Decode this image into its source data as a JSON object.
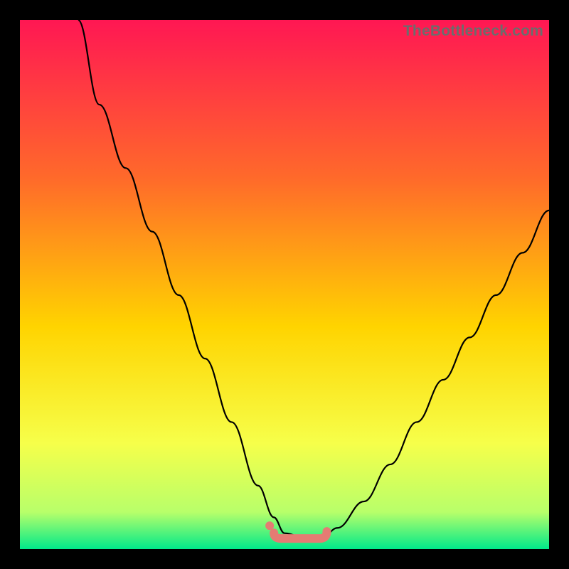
{
  "watermark": "TheBottleneck.com",
  "gradient_colors": {
    "top": "#ff1753",
    "upper_mid": "#ff6a2a",
    "mid": "#ffd400",
    "lower_mid": "#f6ff4a",
    "near_bottom": "#b8ff6a",
    "bottom": "#00e98a"
  },
  "curve_stroke": "#000000",
  "valley_marker_color": "#e57b73",
  "chart_data": {
    "type": "line",
    "title": "",
    "xlabel": "",
    "ylabel": "",
    "xlim": [
      0,
      100
    ],
    "ylim": [
      0,
      100
    ],
    "series": [
      {
        "name": "bottleneck-curve",
        "x": [
          11,
          15,
          20,
          25,
          30,
          35,
          40,
          45,
          48,
          50,
          54,
          57,
          60,
          65,
          70,
          75,
          80,
          85,
          90,
          95,
          100
        ],
        "y": [
          100,
          84,
          72,
          60,
          48,
          36,
          24,
          12,
          6,
          3,
          2,
          2,
          4,
          9,
          16,
          24,
          32,
          40,
          48,
          56,
          64
        ]
      }
    ],
    "valley": {
      "x_range": [
        48,
        58
      ],
      "y": 2
    }
  }
}
